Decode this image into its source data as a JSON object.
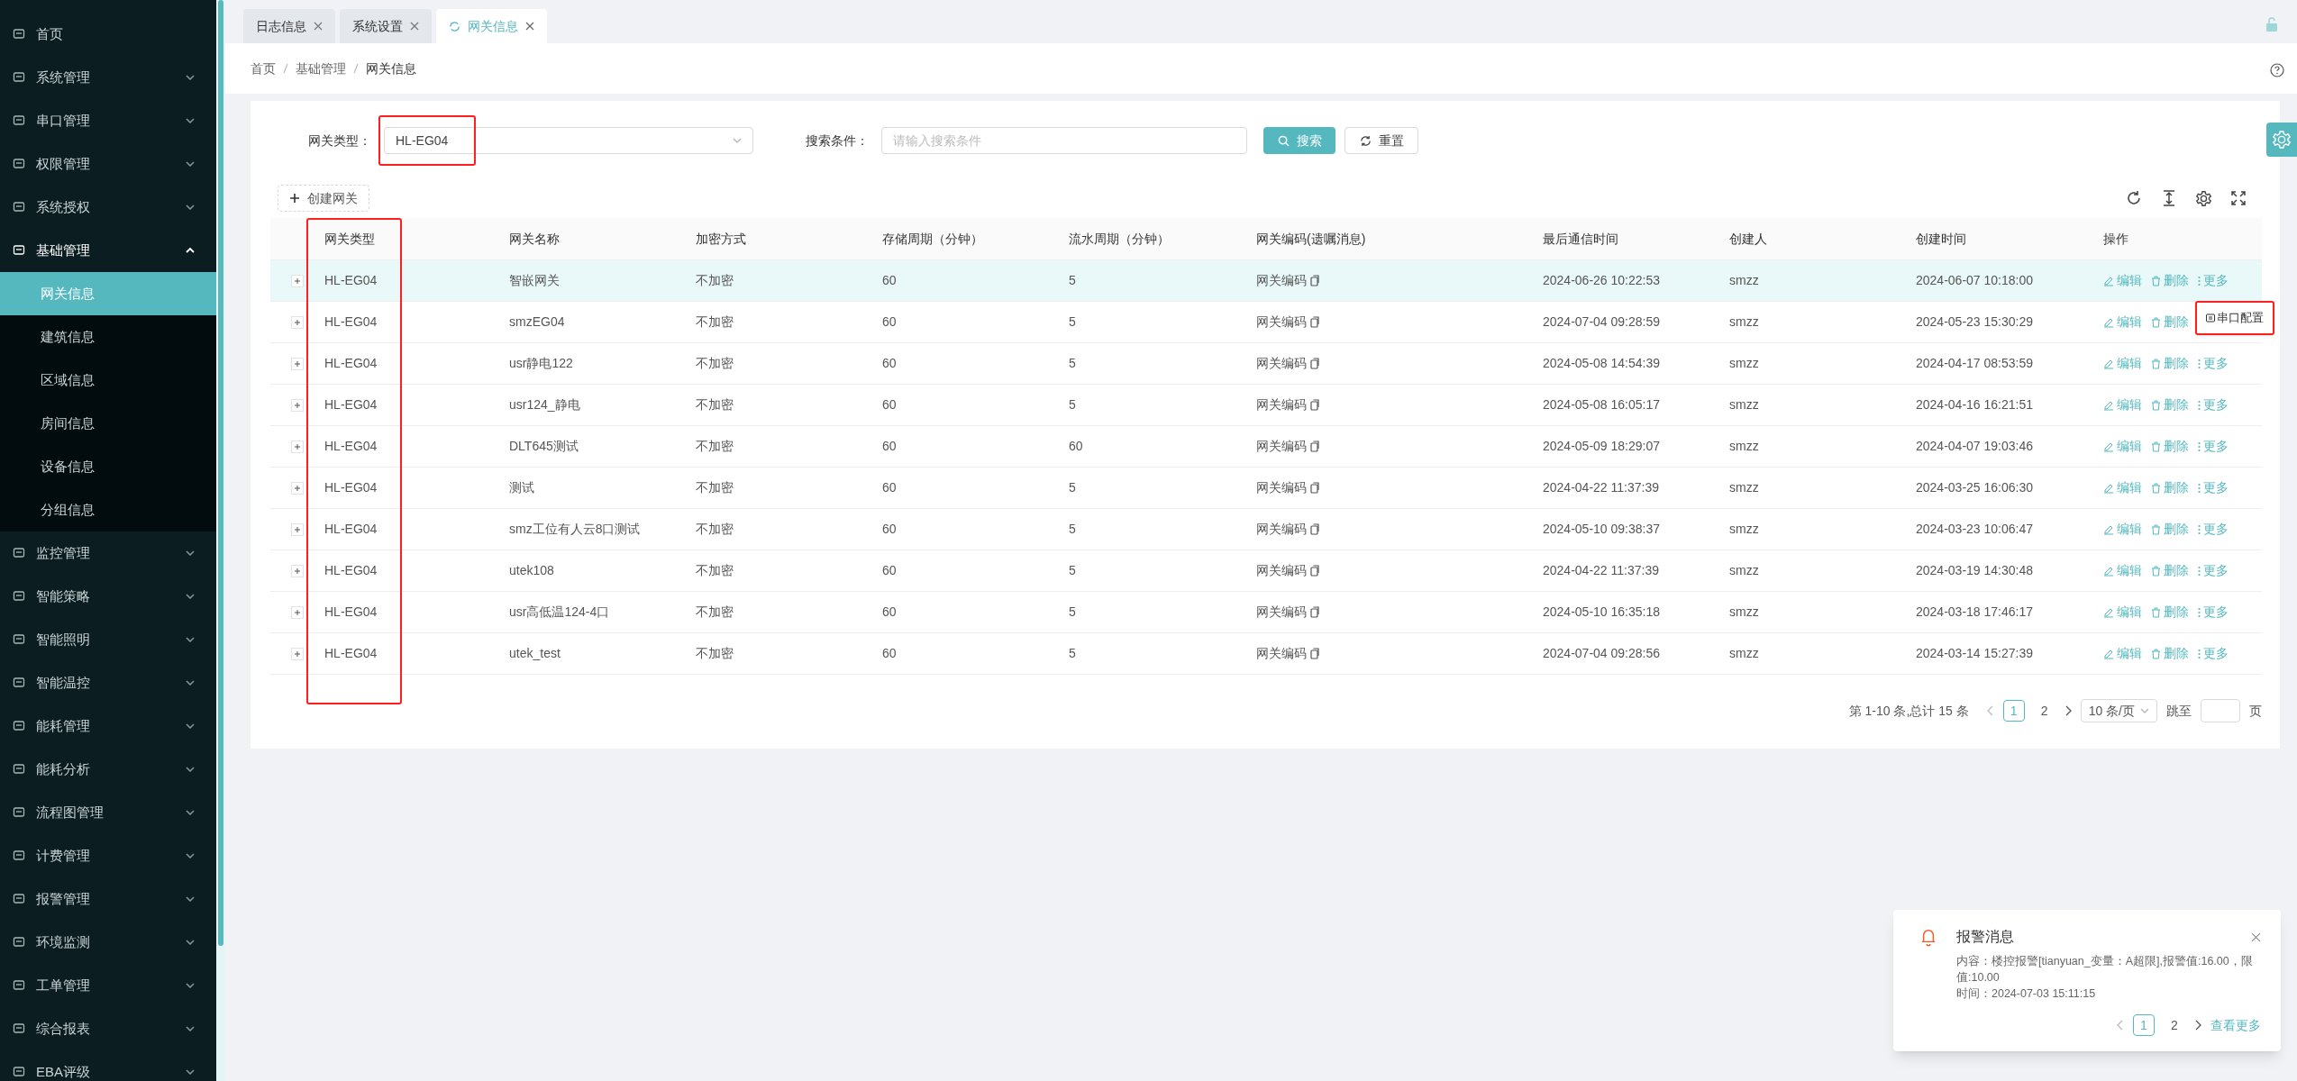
{
  "sidebar": {
    "items": [
      {
        "label": "首页",
        "kind": "link"
      },
      {
        "label": "系统管理",
        "kind": "group",
        "expanded": false
      },
      {
        "label": "串口管理",
        "kind": "group",
        "expanded": false
      },
      {
        "label": "权限管理",
        "kind": "group",
        "expanded": false
      },
      {
        "label": "系统授权",
        "kind": "group",
        "expanded": false
      },
      {
        "label": "基础管理",
        "kind": "group",
        "expanded": true,
        "children": [
          {
            "label": "网关信息",
            "selected": true
          },
          {
            "label": "建筑信息",
            "selected": false
          },
          {
            "label": "区域信息",
            "selected": false
          },
          {
            "label": "房间信息",
            "selected": false
          },
          {
            "label": "设备信息",
            "selected": false
          },
          {
            "label": "分组信息",
            "selected": false
          }
        ]
      },
      {
        "label": "监控管理",
        "kind": "group",
        "expanded": false
      },
      {
        "label": "智能策略",
        "kind": "group",
        "expanded": false
      },
      {
        "label": "智能照明",
        "kind": "group",
        "expanded": false
      },
      {
        "label": "智能温控",
        "kind": "group",
        "expanded": false
      },
      {
        "label": "能耗管理",
        "kind": "group",
        "expanded": false
      },
      {
        "label": "能耗分析",
        "kind": "group",
        "expanded": false
      },
      {
        "label": "流程图管理",
        "kind": "group",
        "expanded": false
      },
      {
        "label": "计费管理",
        "kind": "group",
        "expanded": false
      },
      {
        "label": "报警管理",
        "kind": "group",
        "expanded": false
      },
      {
        "label": "环境监测",
        "kind": "group",
        "expanded": false
      },
      {
        "label": "工单管理",
        "kind": "group",
        "expanded": false
      },
      {
        "label": "综合报表",
        "kind": "group",
        "expanded": false
      },
      {
        "label": "EBA评级",
        "kind": "group",
        "expanded": false
      }
    ]
  },
  "tabs": [
    {
      "label": "日志信息",
      "selected": false
    },
    {
      "label": "系统设置",
      "selected": false
    },
    {
      "label": "网关信息",
      "selected": true
    }
  ],
  "breadcrumb": [
    "首页",
    "基础管理",
    "网关信息"
  ],
  "filters": [
    {
      "kind": "select",
      "label": "网关类型：",
      "value": "HL-EG04",
      "highlighted": true
    },
    {
      "kind": "input",
      "label": "搜索条件：",
      "placeholder": "请输入搜索条件",
      "highlighted": false
    }
  ],
  "search_button": "搜索",
  "reset_button": "重置",
  "create_button": "创建网关",
  "table": {
    "columns": [
      {
        "label": "网关类型",
        "highlighted": true
      },
      {
        "label": "网关名称",
        "highlighted": false
      },
      {
        "label": "加密方式",
        "highlighted": false
      },
      {
        "label": "存储周期（分钟）",
        "highlighted": false
      },
      {
        "label": "流水周期（分钟）",
        "highlighted": false
      },
      {
        "label": "网关编码(遗嘱消息)",
        "highlighted": false
      },
      {
        "label": "最后通信时间",
        "highlighted": false
      },
      {
        "label": "创建人",
        "highlighted": false
      },
      {
        "label": "创建时间",
        "highlighted": false
      },
      {
        "label": "操作",
        "highlighted": false
      }
    ],
    "rows": [
      {
        "hovered": true,
        "cells": [
          "HL-EG04",
          "智嵌网关",
          "不加密",
          "60",
          "5",
          "网关编码",
          "2024-06-26 10:22:53",
          "smzz",
          "2024-06-07 10:18:00"
        ],
        "actions": [
          "编辑",
          "删除",
          "更多"
        ]
      },
      {
        "hovered": false,
        "cells": [
          "HL-EG04",
          "smzEG04",
          "不加密",
          "60",
          "5",
          "网关编码",
          "2024-07-04 09:28:59",
          "smzz",
          "2024-05-23 15:30:29"
        ],
        "actions": [
          "编辑",
          "删除"
        ]
      },
      {
        "hovered": false,
        "cells": [
          "HL-EG04",
          "usr静电122",
          "不加密",
          "60",
          "5",
          "网关编码",
          "2024-05-08 14:54:39",
          "smzz",
          "2024-04-17 08:53:59"
        ],
        "actions": [
          "编辑",
          "删除",
          "更多"
        ]
      },
      {
        "hovered": false,
        "cells": [
          "HL-EG04",
          "usr124_静电",
          "不加密",
          "60",
          "5",
          "网关编码",
          "2024-05-08 16:05:17",
          "smzz",
          "2024-04-16 16:21:51"
        ],
        "actions": [
          "编辑",
          "删除",
          "更多"
        ]
      },
      {
        "hovered": false,
        "cells": [
          "HL-EG04",
          "DLT645测试",
          "不加密",
          "60",
          "60",
          "网关编码",
          "2024-05-09 18:29:07",
          "smzz",
          "2024-04-07 19:03:46"
        ],
        "actions": [
          "编辑",
          "删除",
          "更多"
        ]
      },
      {
        "hovered": false,
        "cells": [
          "HL-EG04",
          "测试",
          "不加密",
          "60",
          "5",
          "网关编码",
          "2024-04-22 11:37:39",
          "smzz",
          "2024-03-25 16:06:30"
        ],
        "actions": [
          "编辑",
          "删除",
          "更多"
        ]
      },
      {
        "hovered": false,
        "cells": [
          "HL-EG04",
          "smz工位有人云8口测试",
          "不加密",
          "60",
          "5",
          "网关编码",
          "2024-05-10 09:38:37",
          "smzz",
          "2024-03-23 10:06:47"
        ],
        "actions": [
          "编辑",
          "删除",
          "更多"
        ]
      },
      {
        "hovered": false,
        "cells": [
          "HL-EG04",
          "utek108",
          "不加密",
          "60",
          "5",
          "网关编码",
          "2024-04-22 11:37:39",
          "smzz",
          "2024-03-19 14:30:48"
        ],
        "actions": [
          "编辑",
          "删除",
          "更多"
        ]
      },
      {
        "hovered": false,
        "cells": [
          "HL-EG04",
          "usr高低温124-4口",
          "不加密",
          "60",
          "5",
          "网关编码",
          "2024-05-10 16:35:18",
          "smzz",
          "2024-03-18 17:46:17"
        ],
        "actions": [
          "编辑",
          "删除",
          "更多"
        ]
      },
      {
        "hovered": false,
        "cells": [
          "HL-EG04",
          "utek_test",
          "不加密",
          "60",
          "5",
          "网关编码",
          "2024-07-04 09:28:56",
          "smzz",
          "2024-03-14 15:27:39"
        ],
        "actions": [
          "编辑",
          "删除",
          "更多"
        ]
      }
    ]
  },
  "row_menu": {
    "item": "串口配置",
    "highlighted": true
  },
  "pagination": {
    "summary": "第 1-10 条,总计 15 条",
    "pages": [
      {
        "label": "1",
        "selected": true
      },
      {
        "label": "2",
        "selected": false
      }
    ],
    "page_size": "10 条/页",
    "jump_label": "跳至",
    "page_suffix": "页"
  },
  "notification": {
    "title": "报警消息",
    "content": "内容：楼控报警[tianyuan_变量：A超限],报警值:16.00，限值:10.00",
    "time": "时间：2024-07-03 15:11:15",
    "pages": [
      {
        "label": "1",
        "selected": true
      },
      {
        "label": "2",
        "selected": false
      }
    ],
    "more_link": "查看更多"
  }
}
